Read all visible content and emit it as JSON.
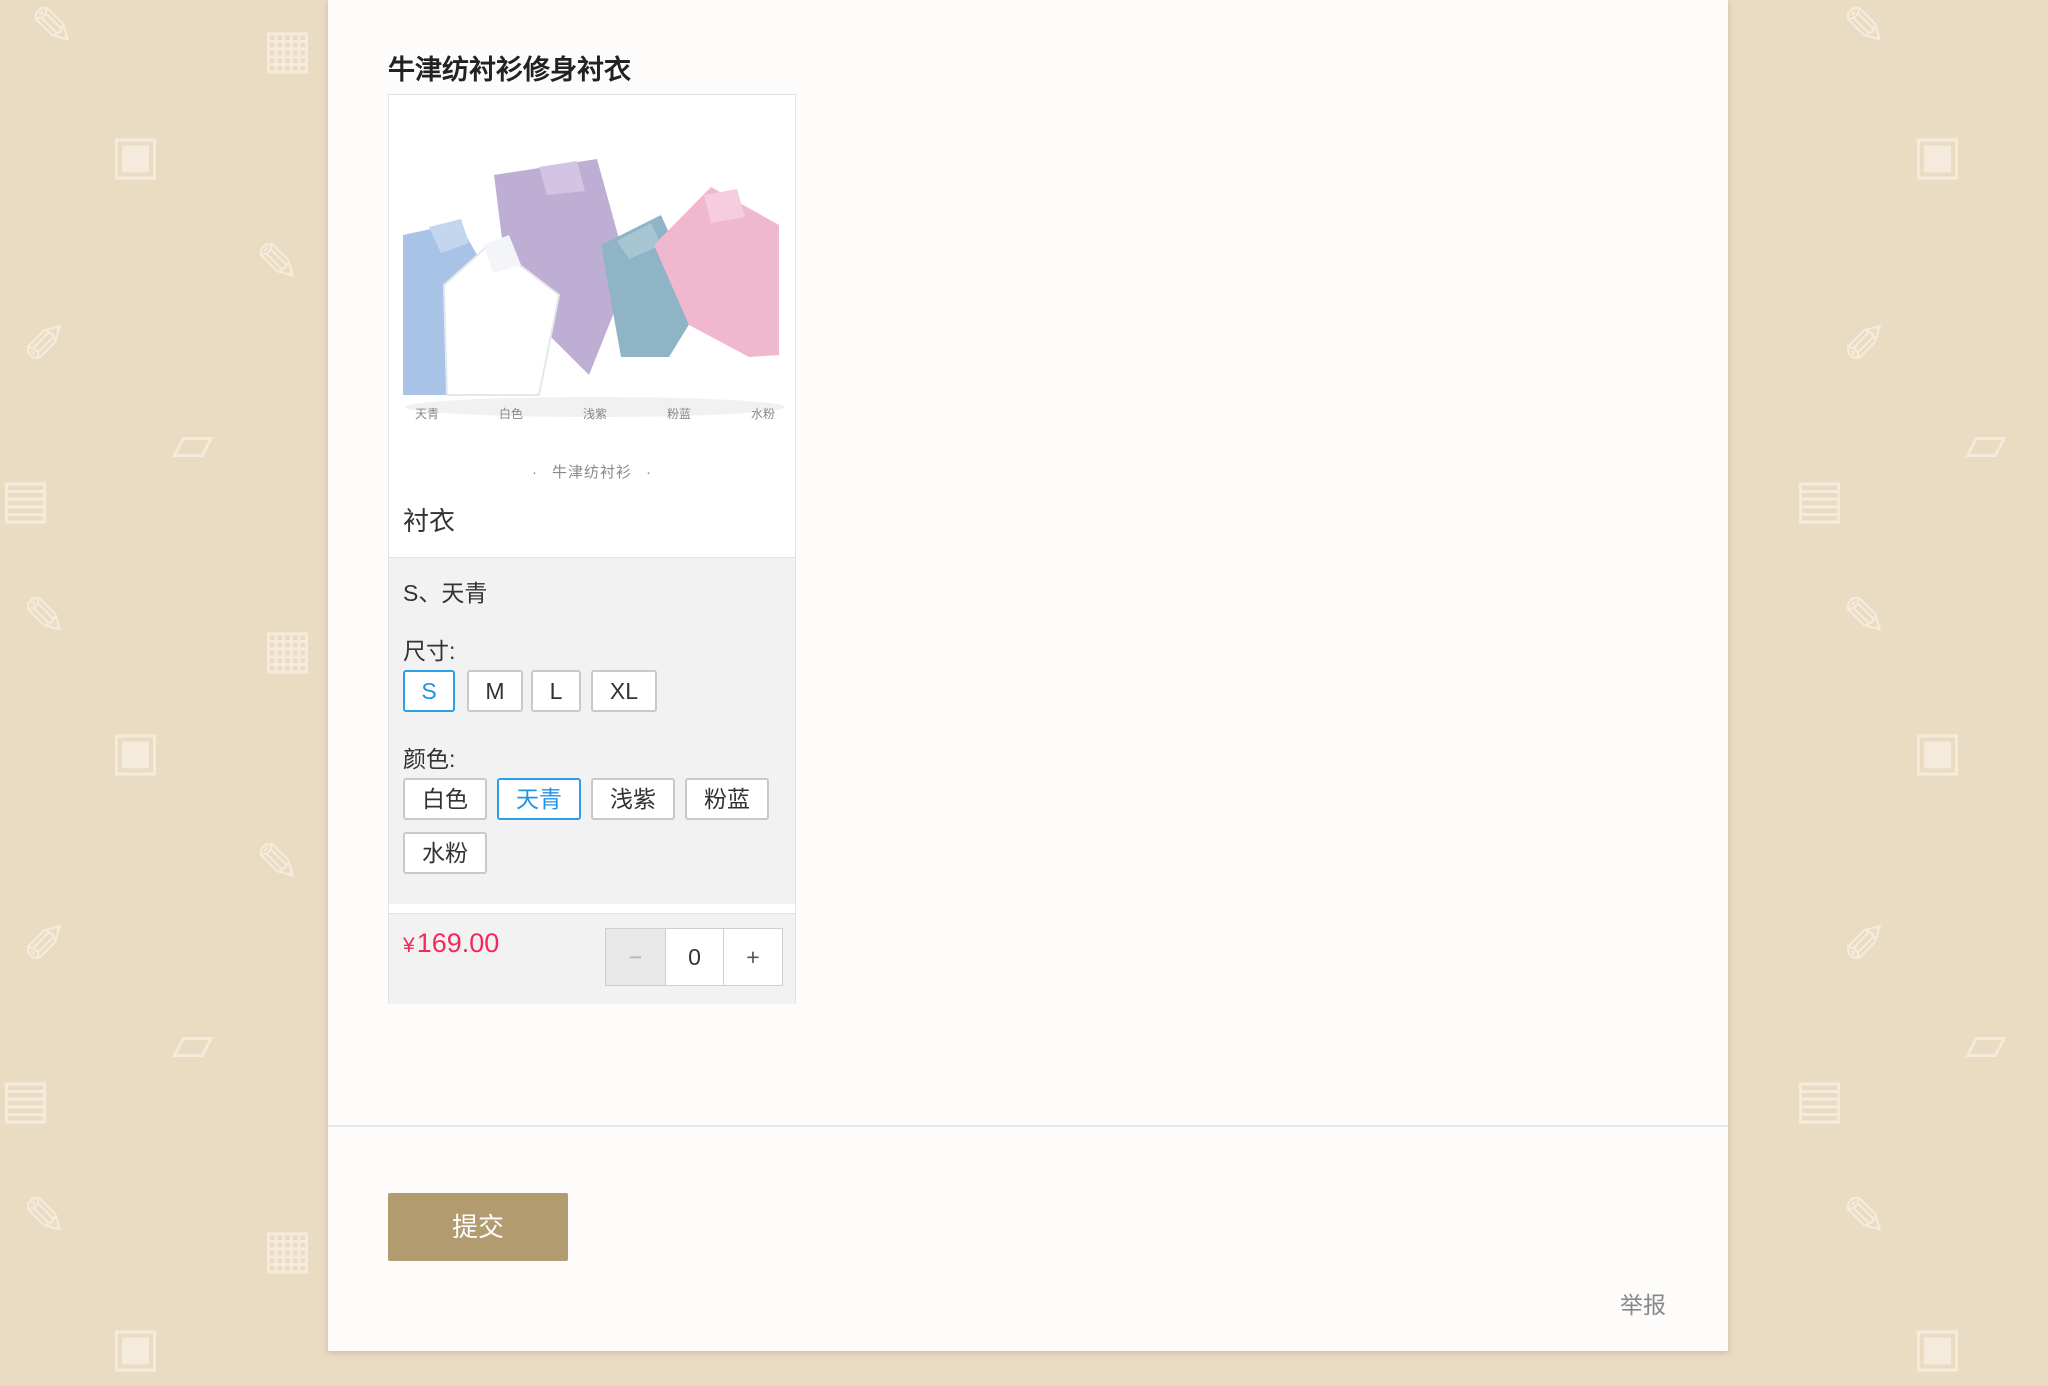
{
  "question": {
    "title": "牛津纺衬衫修身衬衣"
  },
  "product": {
    "image_caption": "牛津纺衬衫",
    "image_color_labels": [
      "天青",
      "白色",
      "浅紫",
      "粉蓝",
      "水粉"
    ],
    "name": "衬衣",
    "selected_summary": "S、天青",
    "size_label": "尺寸:",
    "sizes": [
      "S",
      "M",
      "L",
      "XL"
    ],
    "selected_size": "S",
    "color_label": "颜色:",
    "colors": [
      "白色",
      "天青",
      "浅紫",
      "粉蓝",
      "水粉"
    ],
    "selected_color": "天青",
    "price_symbol": "¥",
    "price": "169.00",
    "quantity": "0",
    "minus_label": "−",
    "plus_label": "+"
  },
  "footer": {
    "submit_label": "提交",
    "report_label": "举报"
  },
  "theme": {
    "accent": "#b29b6e",
    "selected_border": "#2aa0e6",
    "price_color": "#f22a5b",
    "page_bg": "#e9dcc3"
  },
  "background_icons": [
    "pencil-icon",
    "cube-icon",
    "backpack-icon",
    "book-icon",
    "cabinet-icon"
  ]
}
